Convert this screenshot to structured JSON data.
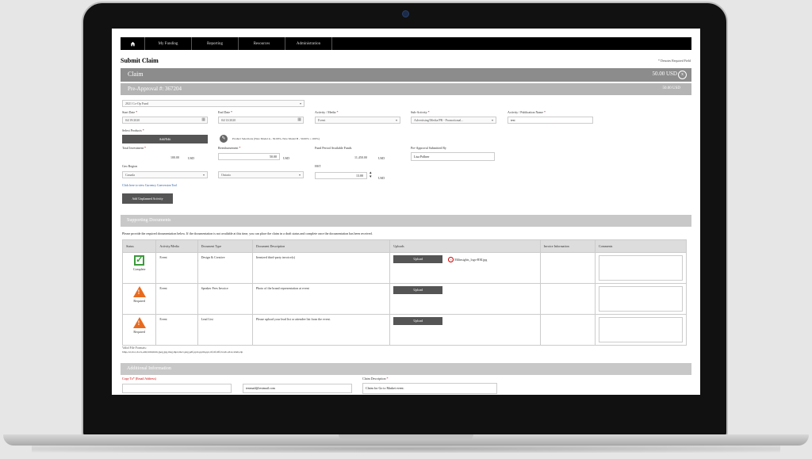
{
  "nav": {
    "items": [
      "My Funding",
      "Reporting",
      "Resources",
      "Administration"
    ]
  },
  "page": {
    "title": "Submit Claim",
    "required_note": "* Denotes Required Field"
  },
  "claim_bar": {
    "label": "Claim",
    "amount": "50.00 USD",
    "close_icon": "x"
  },
  "preapproval_bar": {
    "label": "Pre-Approval #: 367204",
    "amount": "50.00 USD"
  },
  "form": {
    "fund_select": "2021 Co-Op Fund",
    "start_date": {
      "label": "Start Date",
      "value": "04/19/2020"
    },
    "end_date": {
      "label": "End Date",
      "value": "04/13/2020"
    },
    "activity": {
      "label": "Activity / Media",
      "value": "Event"
    },
    "sub_activity": {
      "label": "Sub-Activity",
      "value": "Advertising/Media/PR - Promotional..."
    },
    "pub_name": {
      "label": "Activity / Publication Name",
      "value": "test"
    },
    "select_products": {
      "label": "Select Products",
      "button": "Add/Edit",
      "note": "Product Selections (New Model A - 50.00%, New Model B - 50.00% = 100%)"
    },
    "total_investment": {
      "label": "Total Investment",
      "value": "100.00",
      "unit": "USD"
    },
    "reimbursement": {
      "label": "Reimbursement",
      "value": "50.00",
      "unit": "USD"
    },
    "fund_period": {
      "label": "Fund Period Available Funds",
      "value": "11,450.00",
      "unit": "USD"
    },
    "preapproval_by": {
      "label": "Pre-Approval Submitted By",
      "value": "Lisa Pollner"
    },
    "geo_region": {
      "label": "Geo Region",
      "country": "Canada",
      "province": "Ontario"
    },
    "hst": {
      "label": "HST",
      "value": "13.00",
      "unit": "USD"
    },
    "conversion_link": "Click here to view Currency Conversion Tool",
    "add_activity_button": "Add Unplanned Activity"
  },
  "supporting_docs": {
    "title": "Supporting Documents",
    "instructions": "Please provide the required documentation below. If the documentation is not available at this time, you can place the claim in a draft status and complete once the documentation has been received.",
    "columns": [
      "Status",
      "Activity/Media",
      "Document Type",
      "Document Description",
      "Uploads",
      "Invoice Information",
      "Comments"
    ],
    "rows": [
      {
        "status": "Complete",
        "activity": "Event",
        "doc_type": "Design & Creative",
        "description": "Itemized third-party invoice(s)",
        "upload": "Upload",
        "file": "Milinsights_logo-RM.jpg"
      },
      {
        "status": "Required",
        "activity": "Event",
        "doc_type": "Speaker Fees Invoice",
        "description": "Photo of the brand representation at event",
        "upload": "Upload",
        "file": ""
      },
      {
        "status": "Required",
        "activity": "Event",
        "doc_type": "Lead List",
        "description": "Please upload your lead list or attendee list from the event.",
        "upload": "Upload",
        "file": ""
      }
    ],
    "valid_label": "Valid File Formats:",
    "valid_formats": "bmp,csv,doc,docx,eml,html,htm,jpeg,jpg,msg,mp4,mov,png,pdf,pptx,pptm,ppt,rtf,tif,tiff,txt,xls,xlsx,xlsm,zip"
  },
  "additional": {
    "title": "Additional Information",
    "copy_to": {
      "label": "Copy To* (Email Address)",
      "value": "testmail@testmail.com"
    },
    "claim_desc": {
      "label": "Claim Description",
      "value": "Claim for Go to Market event."
    }
  }
}
